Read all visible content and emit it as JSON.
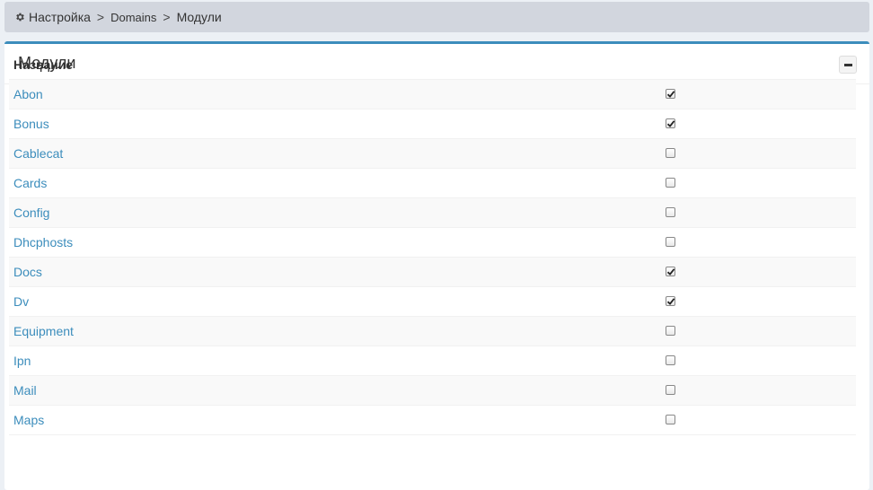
{
  "breadcrumb": {
    "icon": "gear-icon",
    "items": [
      "Настройка",
      "Domains",
      "Модули"
    ],
    "separator": ">"
  },
  "panel": {
    "title": "Модули",
    "collapse_icon": "minus-icon",
    "accent_color": "#3c8dbc"
  },
  "table": {
    "header": "Название",
    "rows": [
      {
        "name": "Abon",
        "checked": true
      },
      {
        "name": "Bonus",
        "checked": true
      },
      {
        "name": "Cablecat",
        "checked": false
      },
      {
        "name": "Cards",
        "checked": false
      },
      {
        "name": "Config",
        "checked": false
      },
      {
        "name": "Dhcphosts",
        "checked": false
      },
      {
        "name": "Docs",
        "checked": true
      },
      {
        "name": "Dv",
        "checked": true
      },
      {
        "name": "Equipment",
        "checked": false
      },
      {
        "name": "Ipn",
        "checked": false
      },
      {
        "name": "Mail",
        "checked": false
      },
      {
        "name": "Maps",
        "checked": false
      }
    ]
  }
}
